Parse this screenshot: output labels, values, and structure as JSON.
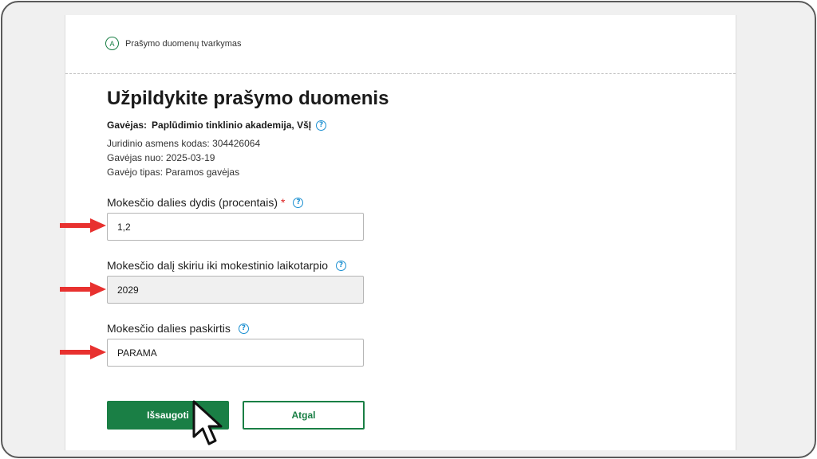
{
  "step": {
    "badge": "A",
    "label": "Prašymo duomenų tvarkymas"
  },
  "page": {
    "title": "Užpildykite prašymo duomenis"
  },
  "recipient": {
    "label": "Gavėjas:",
    "name": "Paplūdimio tinklinio akademija, VšĮ",
    "legal_code": "Juridinio asmens kodas: 304426064",
    "since": "Gavėjas nuo: 2025-03-19",
    "type": "Gavėjo tipas: Paramos gavėjas"
  },
  "fields": [
    {
      "label": "Mokesčio dalies dydis (procentais)",
      "required_mark": "*",
      "value": "1,2"
    },
    {
      "label": "Mokesčio dalį skiriu iki mokestinio laikotarpio",
      "value": "2029"
    },
    {
      "label": "Mokesčio dalies paskirtis",
      "value": "PARAMA"
    }
  ],
  "help_glyph": "?",
  "buttons": {
    "save": "Išsaugoti",
    "back": "Atgal"
  },
  "colors": {
    "accent": "#1a7f45",
    "help": "#1a8fd1",
    "annotation_arrow": "#e8312f"
  }
}
